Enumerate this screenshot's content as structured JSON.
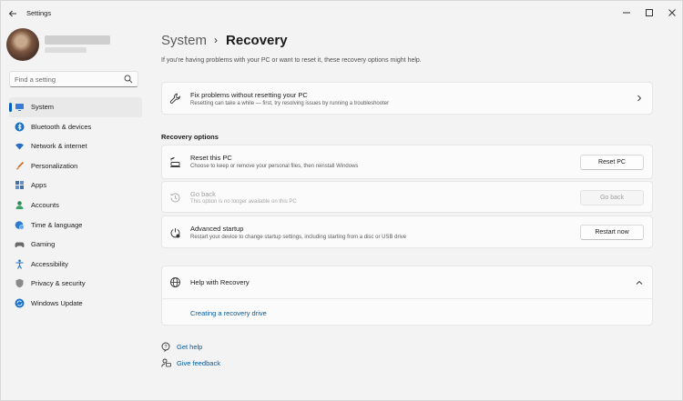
{
  "window": {
    "title": "Settings",
    "back_icon": "arrow-left-icon",
    "controls": {
      "minimize": "—",
      "maximize": "maximize-icon",
      "close": "✕"
    }
  },
  "sidebar": {
    "search_placeholder": "Find a setting",
    "items": [
      {
        "label": "System",
        "icon": "monitor-icon",
        "color": "#3a7bd5",
        "active": true
      },
      {
        "label": "Bluetooth & devices",
        "icon": "bluetooth-icon",
        "color": "#1a73c9"
      },
      {
        "label": "Network & internet",
        "icon": "wifi-icon",
        "color": "#2a6fc2"
      },
      {
        "label": "Personalization",
        "icon": "brush-icon",
        "color": "#c96a2a"
      },
      {
        "label": "Apps",
        "icon": "apps-icon",
        "color": "#4a6fa5"
      },
      {
        "label": "Accounts",
        "icon": "person-icon",
        "color": "#2f8a5a"
      },
      {
        "label": "Time & language",
        "icon": "globe-clock-icon",
        "color": "#2b7bd0"
      },
      {
        "label": "Gaming",
        "icon": "gamepad-icon",
        "color": "#6b6b6b"
      },
      {
        "label": "Accessibility",
        "icon": "accessibility-icon",
        "color": "#1e6fc0"
      },
      {
        "label": "Privacy & security",
        "icon": "shield-icon",
        "color": "#7a7a7a"
      },
      {
        "label": "Windows Update",
        "icon": "update-icon",
        "color": "#1a73c9"
      }
    ]
  },
  "main": {
    "breadcrumb": {
      "parent": "System",
      "separator": "›",
      "current": "Recovery"
    },
    "intro": "If you're having problems with your PC or want to reset it, these recovery options might help.",
    "fix_card": {
      "title": "Fix problems without resetting your PC",
      "desc": "Resetting can take a while — first, try resolving issues by running a troubleshooter"
    },
    "recovery_options_label": "Recovery options",
    "options": [
      {
        "title": "Reset this PC",
        "desc": "Choose to keep or remove your personal files, then reinstall Windows",
        "button": "Reset PC",
        "enabled": true
      },
      {
        "title": "Go back",
        "desc": "This option is no longer available on this PC",
        "button": "Go back",
        "enabled": false
      },
      {
        "title": "Advanced startup",
        "desc": "Restart your device to change startup settings, including starting from a disc or USB drive",
        "button": "Restart now",
        "enabled": true
      }
    ],
    "help": {
      "title": "Help with Recovery",
      "link": "Creating a recovery drive"
    },
    "footer_links": {
      "get_help": "Get help",
      "give_feedback": "Give feedback"
    }
  }
}
